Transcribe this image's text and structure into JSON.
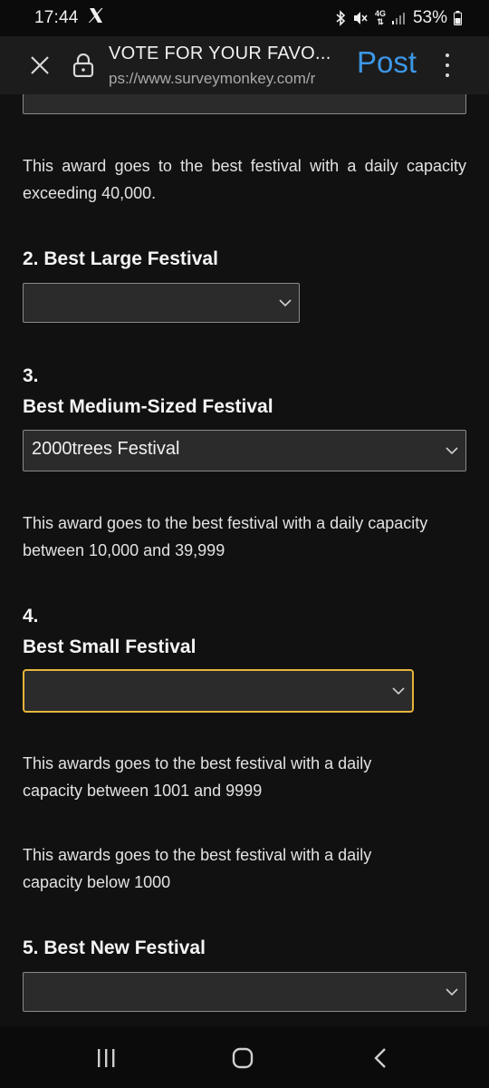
{
  "status_bar": {
    "time": "17:44",
    "app_icon": "x-logo",
    "network": "4G",
    "battery": "53%",
    "icons": [
      "bluetooth-icon",
      "mute-icon",
      "network-4g-icon",
      "signal-icon",
      "battery-icon"
    ]
  },
  "toolbar": {
    "title": "VOTE FOR YOUR FAVO...",
    "url": "ps://www.surveymonkey.com/r",
    "post_label": "Post"
  },
  "survey": {
    "q1_description": "This award goes to the best festival with a daily capacity exceeding 40,000.",
    "q2": {
      "title": "2. Best Large Festival",
      "selected": ""
    },
    "q3": {
      "number": "3.",
      "title": "Best Medium-Sized Festival",
      "selected": "2000trees Festival",
      "description": "This award goes to the best festival with a daily capacity between 10,000 and 39,999"
    },
    "q4": {
      "number": "4.",
      "title": "Best Small Festival",
      "selected": "",
      "description_1": "This awards goes to the best festival with a daily capacity between 1001 and 9999",
      "description_2": "This awards goes to the best festival with a daily capacity below 1000"
    },
    "q5": {
      "title": "5. Best New Festival",
      "selected": ""
    }
  },
  "colors": {
    "accent_link": "#3d97e6",
    "focus_ring": "#e6b43c",
    "background": "#111111"
  }
}
